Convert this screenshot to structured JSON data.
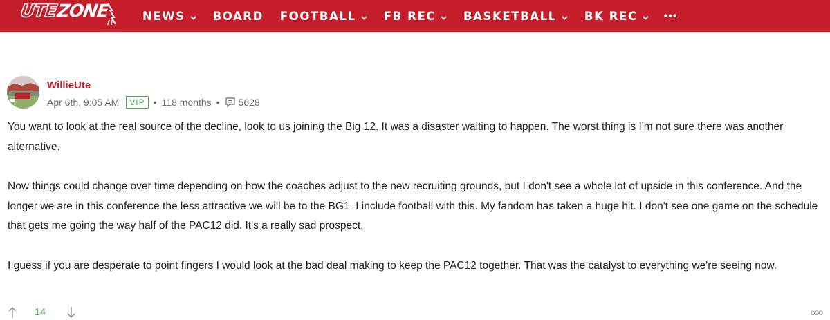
{
  "site": {
    "logo_text_ute": "UTE",
    "logo_text_zone": "ZONE",
    "accent_color": "#c41e2a"
  },
  "nav": {
    "items": [
      {
        "label": "NEWS",
        "dropdown": true
      },
      {
        "label": "BOARD",
        "dropdown": false
      },
      {
        "label": "FOOTBALL",
        "dropdown": true
      },
      {
        "label": "FB REC",
        "dropdown": true
      },
      {
        "label": "BASKETBALL",
        "dropdown": true
      },
      {
        "label": "BK REC",
        "dropdown": true
      }
    ],
    "more_label": "•••"
  },
  "post": {
    "author": "WillieUte",
    "timestamp": "Apr 6th, 9:05 AM",
    "badge": "VIP",
    "tenure": "118 months",
    "message_count": "5628",
    "paragraphs": [
      "You want to look at the real source of the decline, look to us joining the Big 12. It was a disaster waiting to happen. The worst thing is I'm not sure there was another alternative.",
      "Now things could change over time depending on how the coaches adjust to the new recruiting grounds, but I don't see a whole lot of upside in this conference. And the longer we are in this conference the less attractive we will be to the BG1. I include football with this. My fandom has taken a huge hit. I don't see one game on the schedule that gets me going the way half of the PAC12 did. It's a really sad prospect.",
      "I guess if you are desperate to point fingers I would look at the bad deal making to keep the PAC12 together. That was the catalyst to everything we're seeing now."
    ],
    "score": "14",
    "options_label": "ooo"
  }
}
